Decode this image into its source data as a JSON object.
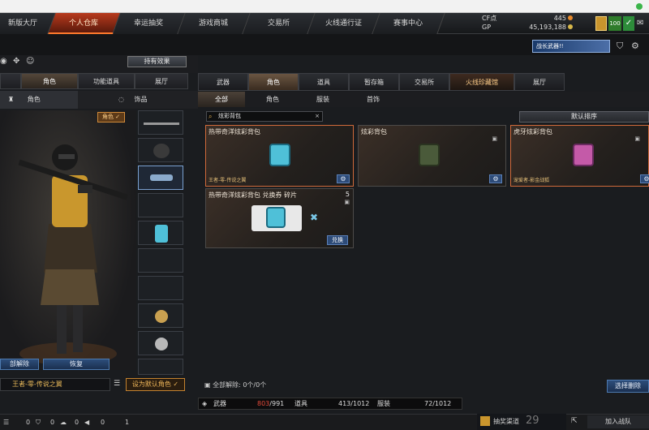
{
  "nav": {
    "tabs": [
      "新版大厅",
      "个人仓库",
      "幸运抽奖",
      "游戏商城",
      "交易所",
      "火线通行证",
      "赛事中心"
    ],
    "active_index": 1
  },
  "currency": {
    "cf_label": "CF点",
    "cf_value": "445",
    "gp_label": "GP",
    "gp_value": "45,193,188"
  },
  "header": {
    "level": "100",
    "banner_text": "战长武器!!"
  },
  "left": {
    "effect_button": "持有效果",
    "tabs": [
      "角色",
      "功能道具",
      "展厅"
    ],
    "active_tab": 0,
    "subtabs": [
      "角色",
      "饰品"
    ],
    "badge": "角色 ✓",
    "unequip_button": "部解除",
    "restore_button": "恢复",
    "character_name": "王者-零-传说之翼",
    "default_button": "设为默认角色 ✓"
  },
  "right": {
    "tabs": [
      "武器",
      "角色",
      "道具",
      "暂存箱",
      "交易所",
      "火线珍藏馆",
      "展厅"
    ],
    "active_tab": 1,
    "special_tab": 5,
    "subtabs": [
      "全部",
      "角色",
      "服装",
      "首饰"
    ],
    "active_subtab": 0,
    "search": {
      "value": "炫彩背包"
    },
    "sort_button": "默认排序",
    "cards": [
      {
        "title": "热带奇洋炫彩背包",
        "footer": "王者-零-传说之翼",
        "color": "#4fc0d8"
      },
      {
        "title": "炫彩背包",
        "footer": "",
        "color": "#4a5a3a"
      },
      {
        "title": "虎牙炫彩背包",
        "footer": "宠爱者-影金战狐",
        "color": "#c45aa8"
      },
      {
        "title": "热带奇洋炫彩背包 兑换券 碎片",
        "count": "5",
        "exchange": "兑换",
        "color": "#4fc0d8"
      }
    ],
    "unequip_info": "全部解除: 0个/0个",
    "batch_button": "选择删除",
    "capacity": [
      {
        "label": "武器",
        "used": "803",
        "total": "991"
      },
      {
        "label": "道具",
        "used": "413",
        "total": "1012"
      },
      {
        "label": "服装",
        "used": "72",
        "total": "1012"
      }
    ]
  },
  "status": {
    "values": [
      "0",
      "0",
      "0",
      "0",
      "1"
    ],
    "channel": "抽奖渠道",
    "channel_num": "29",
    "join_team": "加入战队"
  },
  "colors": {
    "accent": "#ff7a2d",
    "blue_button": "#2d4b78",
    "gold": "#e8b95a",
    "warn": "#e24a3a"
  }
}
